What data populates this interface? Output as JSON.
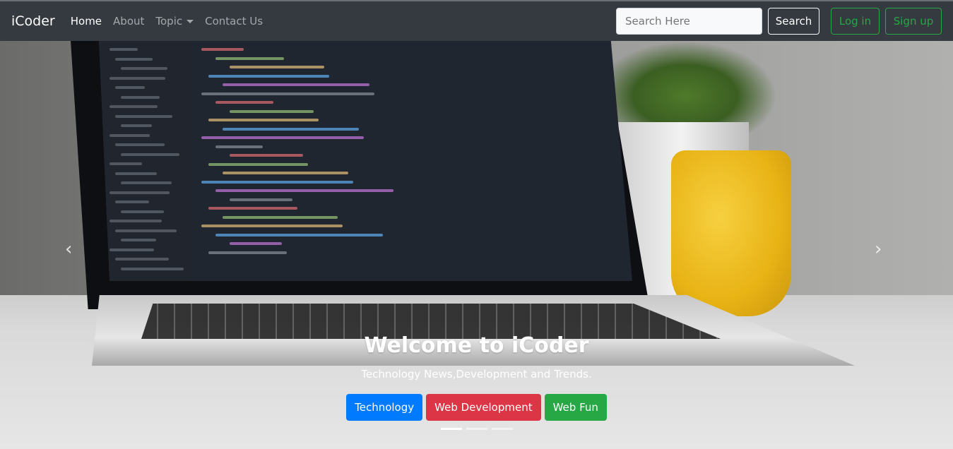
{
  "navbar": {
    "brand": "iCoder",
    "links": [
      {
        "label": "Home",
        "active": true
      },
      {
        "label": "About"
      },
      {
        "label": "Topic",
        "dropdown": true
      },
      {
        "label": "Contact Us"
      }
    ],
    "search_placeholder": "Search Here",
    "search_button": "Search",
    "login": "Log in",
    "signup": "Sign up"
  },
  "carousel": {
    "title": "Welcome to iCoder",
    "subtitle": "Technology News,Development and Trends.",
    "buttons": [
      {
        "label": "Technology",
        "color": "#007bff"
      },
      {
        "label": "Web Development",
        "color": "#dc3545"
      },
      {
        "label": "Web Fun",
        "color": "#28a745"
      }
    ],
    "slides": 3,
    "active_slide": 1,
    "prev_icon": "chevron-left-icon",
    "next_icon": "chevron-right-icon"
  }
}
